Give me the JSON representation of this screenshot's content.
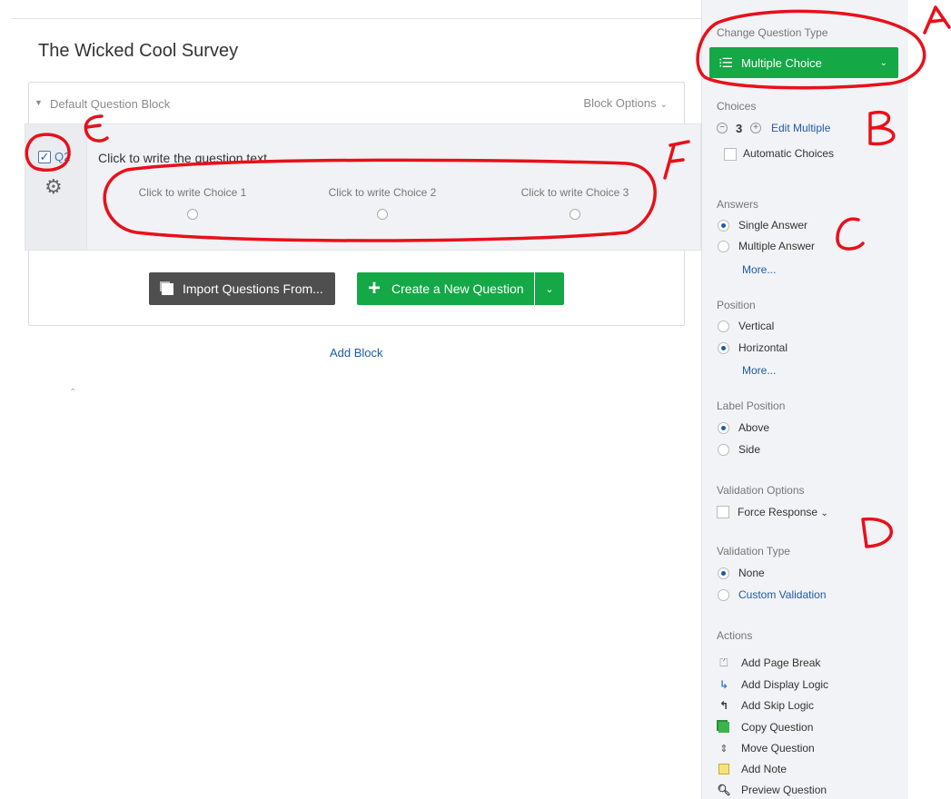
{
  "survey": {
    "title": "The Wicked Cool Survey"
  },
  "block": {
    "name": "Default Question Block",
    "options_label": "Block Options",
    "import_button": "Import Questions From...",
    "create_button": "Create a New Question",
    "add_block_link": "Add Block"
  },
  "question": {
    "number": "Q2",
    "selected": true,
    "text": "Click to write the question text",
    "choices": [
      "Click to write Choice 1",
      "Click to write Choice 2",
      "Click to write Choice 3"
    ]
  },
  "sidebar": {
    "change_type": {
      "heading": "Change Question Type",
      "value": "Multiple Choice"
    },
    "choices": {
      "heading": "Choices",
      "count": "3",
      "edit_multiple": "Edit Multiple",
      "automatic": "Automatic Choices"
    },
    "answers": {
      "heading": "Answers",
      "options": [
        "Single Answer",
        "Multiple Answer"
      ],
      "selected": "Single Answer",
      "more": "More..."
    },
    "position": {
      "heading": "Position",
      "options": [
        "Vertical",
        "Horizontal"
      ],
      "selected": "Horizontal",
      "more": "More..."
    },
    "label_position": {
      "heading": "Label Position",
      "options": [
        "Above",
        "Side"
      ],
      "selected": "Above"
    },
    "validation_options": {
      "heading": "Validation Options",
      "force_response": "Force Response"
    },
    "validation_type": {
      "heading": "Validation Type",
      "options": [
        "None",
        "Custom Validation"
      ],
      "selected": "None"
    },
    "actions": {
      "heading": "Actions",
      "items": [
        {
          "label": "Add Page Break",
          "icon": "page-break-icon"
        },
        {
          "label": "Add Display Logic",
          "icon": "display-logic-icon"
        },
        {
          "label": "Add Skip Logic",
          "icon": "skip-logic-icon"
        },
        {
          "label": "Copy Question",
          "icon": "copy-icon"
        },
        {
          "label": "Move Question",
          "icon": "move-icon"
        },
        {
          "label": "Add Note",
          "icon": "note-icon"
        },
        {
          "label": "Preview Question",
          "icon": "search-icon"
        }
      ]
    }
  },
  "annotations": {
    "a": "A",
    "b": "B",
    "c": "C",
    "d": "D",
    "e": "E",
    "f": "F"
  },
  "colors": {
    "accent_green": "#14a846",
    "link_blue": "#1f5aa8",
    "annotation_red": "#e8101a"
  }
}
